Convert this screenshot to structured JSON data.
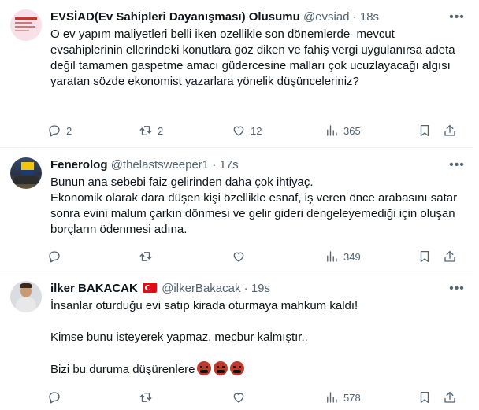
{
  "tweets": [
    {
      "name": "EVSİAD(Ev Sahipleri Dayanışması) Olusumu",
      "handle": "@evsiad",
      "time": "18s",
      "text": "O ev yapım maliyetleri belli iken ozellikle son dönemlerde  mevcut evsahiplerinin ellerindeki konutlara göz diken ve fahiş vergi uygulanırsa adeta değil tamamen gaspetme amacı güdercesine malları çok ucuzlayacağı algısı yaratan sözde ekonomist yazarlara yönelik düşünceleriniz?",
      "replies": "2",
      "retweets": "2",
      "likes": "12",
      "views": "365"
    },
    {
      "name": "Fenerolog",
      "handle": "@thelastsweeper1",
      "time": "17s",
      "text": "Bunun ana sebebi faiz gelirinden daha çok ihtiyaç.\nEkonomik olarak dara düşen kişi özellikle esnaf, iş veren önce arabasını satar sonra evini malum çarkın dönmesi ve gelir gideri dengeleyemediği için oluşan borçların ödenmesi adına.",
      "replies": "",
      "retweets": "",
      "likes": "",
      "views": "349"
    },
    {
      "name": "ilker BAKACAK",
      "handle": "@ilkerBakacak",
      "time": "19s",
      "text": "İnsanlar oturduğu evi satıp kirada oturmaya mahkum kaldı!\n\nKimse bunu isteyerek yapmaz, mecbur kalmıştır..\n\nBizi bu duruma düşürenlere",
      "replies": "",
      "retweets": "",
      "likes": "",
      "views": "578"
    }
  ],
  "icons": {
    "reply": "reply-icon",
    "retweet": "retweet-icon",
    "like": "heart-icon",
    "views": "views-icon",
    "bookmark": "bookmark-icon",
    "share": "share-icon",
    "more": "more-icon",
    "flag": "turkey-flag-icon",
    "emoji": "angry-face-icon"
  },
  "colors": {
    "text": "#0f1419",
    "secondary": "#536471",
    "divider": "#eff3f4"
  }
}
